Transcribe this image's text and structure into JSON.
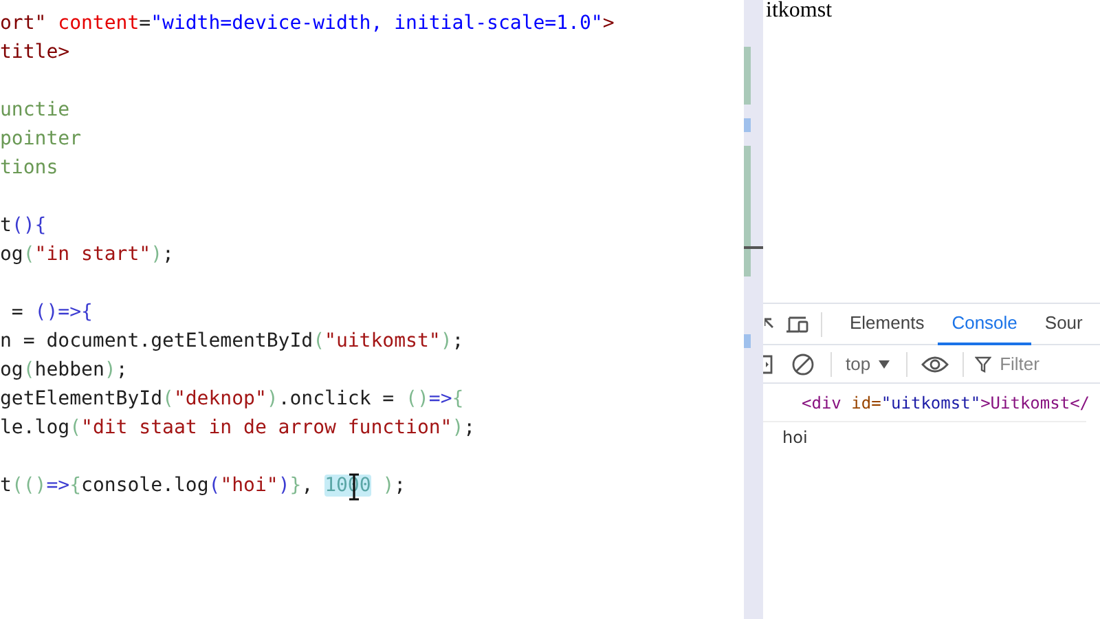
{
  "editor": {
    "lines": [
      {
        "gap_before": false,
        "tokens": [
          {
            "kind": "tag",
            "text": "ort\""
          },
          {
            "kind": "attr",
            "text": " content"
          },
          {
            "kind": "plain",
            "text": "="
          },
          {
            "kind": "value",
            "text": "\"width=device-width, initial-scale=1.0\""
          },
          {
            "kind": "tag",
            "text": ">"
          }
        ]
      },
      {
        "gap_before": false,
        "tokens": [
          {
            "kind": "tag",
            "text": "title>"
          }
        ]
      },
      {
        "gap_before": true,
        "tokens": [
          {
            "kind": "comment",
            "text": "unctie"
          }
        ]
      },
      {
        "gap_before": false,
        "tokens": [
          {
            "kind": "comment",
            "text": "pointer"
          }
        ]
      },
      {
        "gap_before": false,
        "tokens": [
          {
            "kind": "comment",
            "text": "tions"
          }
        ]
      },
      {
        "gap_before": true,
        "tokens": [
          {
            "kind": "plain",
            "text": "t"
          },
          {
            "kind": "bracket",
            "text": "(){"
          }
        ]
      },
      {
        "gap_before": false,
        "tokens": [
          {
            "kind": "plain",
            "text": "og"
          },
          {
            "kind": "paren",
            "text": "("
          },
          {
            "kind": "string",
            "text": "\"in start\""
          },
          {
            "kind": "paren",
            "text": ")"
          },
          {
            "kind": "plain",
            "text": ";"
          }
        ]
      },
      {
        "gap_before": true,
        "tokens": [
          {
            "kind": "plain",
            "text": " = "
          },
          {
            "kind": "bracket",
            "text": "()=>{"
          }
        ]
      },
      {
        "gap_before": false,
        "tokens": [
          {
            "kind": "plain",
            "text": "n = document.getElementById"
          },
          {
            "kind": "paren",
            "text": "("
          },
          {
            "kind": "string",
            "text": "\"uitkomst\""
          },
          {
            "kind": "paren",
            "text": ")"
          },
          {
            "kind": "plain",
            "text": ";"
          }
        ]
      },
      {
        "gap_before": false,
        "tokens": [
          {
            "kind": "plain",
            "text": "og"
          },
          {
            "kind": "paren",
            "text": "("
          },
          {
            "kind": "plain",
            "text": "hebben"
          },
          {
            "kind": "paren",
            "text": ")"
          },
          {
            "kind": "plain",
            "text": ";"
          }
        ]
      },
      {
        "gap_before": false,
        "tokens": [
          {
            "kind": "plain",
            "text": "getElementById"
          },
          {
            "kind": "paren",
            "text": "("
          },
          {
            "kind": "string",
            "text": "\"deknop\""
          },
          {
            "kind": "paren",
            "text": ")"
          },
          {
            "kind": "plain",
            "text": ".onclick = "
          },
          {
            "kind": "paren",
            "text": "()"
          },
          {
            "kind": "bracket",
            "text": "=>"
          },
          {
            "kind": "paren",
            "text": "{"
          }
        ]
      },
      {
        "gap_before": false,
        "tokens": [
          {
            "kind": "plain",
            "text": "le.log"
          },
          {
            "kind": "paren",
            "text": "("
          },
          {
            "kind": "string",
            "text": "\"dit staat in de arrow function\""
          },
          {
            "kind": "paren",
            "text": ")"
          },
          {
            "kind": "plain",
            "text": ";"
          }
        ]
      },
      {
        "gap_before": true,
        "tokens": [
          {
            "kind": "plain",
            "text": "t"
          },
          {
            "kind": "paren",
            "text": "(()"
          },
          {
            "kind": "bracket",
            "text": "=>"
          },
          {
            "kind": "paren",
            "text": "{"
          },
          {
            "kind": "plain",
            "text": "console.log"
          },
          {
            "kind": "bracket",
            "text": "("
          },
          {
            "kind": "string",
            "text": "\"hoi\""
          },
          {
            "kind": "bracket",
            "text": ")"
          },
          {
            "kind": "paren",
            "text": "}"
          },
          {
            "kind": "plain",
            "text": ", "
          },
          {
            "kind": "selected-number",
            "text": "1000"
          },
          {
            "kind": "paren",
            "text": " )"
          },
          {
            "kind": "plain",
            "text": ";"
          }
        ]
      }
    ]
  },
  "page": {
    "text": "itkomst"
  },
  "devtools": {
    "tabs": [
      {
        "label": "Elements",
        "selected": false
      },
      {
        "label": "Console",
        "selected": true
      },
      {
        "label": "Sour",
        "selected": false
      }
    ],
    "context": "top",
    "filter": {
      "placeholder": "Filter"
    },
    "console": [
      {
        "kind": "element",
        "tag_open": "<div ",
        "attr": "id=",
        "value": "\"uitkomst\"",
        "content": ">Uitkomst</"
      },
      {
        "kind": "log",
        "text": "hoi"
      }
    ]
  }
}
